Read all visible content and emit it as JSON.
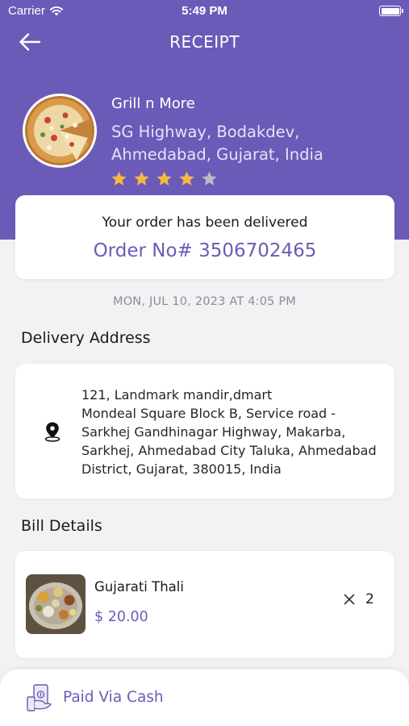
{
  "status_bar": {
    "carrier": "Carrier",
    "time": "5:49 PM"
  },
  "nav": {
    "title": "RECEIPT"
  },
  "store": {
    "name": "Grill n More",
    "address": "SG Highway, Bodakdev, Ahmedabad, Gujarat, India",
    "rating": 4,
    "rating_max": 5
  },
  "order": {
    "status": "Your order has been delivered",
    "number_label": "Order No# 3506702465",
    "datetime": "MON, JUL 10, 2023 AT 4:05 PM"
  },
  "delivery": {
    "title": "Delivery Address",
    "address_lines": [
      "121, Landmark mandir,dmart",
      "Mondeal Square Block B, Service road -",
      "Sarkhej Gandhinagar Highway, Makarba,",
      "Sarkhej, Ahmedabad City Taluka, Ahmedabad",
      "District, Gujarat, 380015, India"
    ]
  },
  "bill": {
    "title": "Bill Details",
    "items": [
      {
        "name": "Gujarati Thali",
        "price": "$ 20.00",
        "quantity": "2"
      }
    ]
  },
  "payment": {
    "label": "Paid Via Cash"
  },
  "colors": {
    "accent": "#6b5bb8",
    "background": "#f2f2f4",
    "star_filled": "#f5b942",
    "star_empty": "#b9bcc6"
  }
}
